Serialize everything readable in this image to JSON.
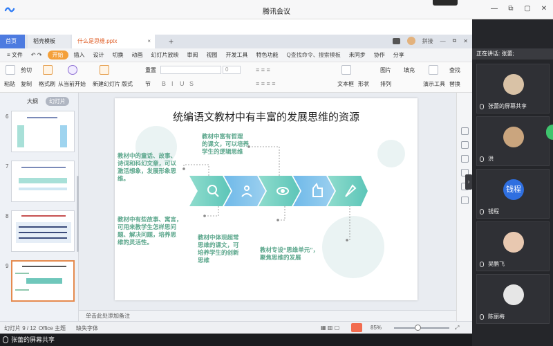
{
  "meeting": {
    "title": "腾讯会议",
    "screen_share_label": "张蕾的屏幕共享",
    "speaking_label": "正在讲话: 张蕾;",
    "win_min": "—",
    "win_restore": "⧉",
    "win_max": "▢",
    "win_close": "✕"
  },
  "wps": {
    "tabs": {
      "home": "首页",
      "template": "稻壳模板",
      "doc": "什么是思维.pptx",
      "add": "+"
    },
    "tabs_right": {
      "page_badge": "1",
      "user_label": "拼接"
    },
    "menu": {
      "file": "≡ 文件",
      "items": [
        "开始",
        "插入",
        "设计",
        "切换",
        "动画",
        "幻灯片放映",
        "审阅",
        "视图",
        "开发工具",
        "特色功能"
      ],
      "active_index": 0,
      "search": "Q查找命令、搜索模板",
      "unsync": "未同步",
      "collab": "协作",
      "share": "分享"
    },
    "ribbon": {
      "paste": "粘贴",
      "cut": "剪切",
      "copy": "复制",
      "format_painter": "格式刷",
      "play_from_current": "从当前开始",
      "new_slide": "新建幻灯片",
      "layout": "版式",
      "section": "节",
      "reset": "重置",
      "textbox": "文本框",
      "shape": "形状",
      "arrange": "排列",
      "picture": "图片",
      "fill": "填充",
      "find": "查找",
      "replace": "替换",
      "slideshow_tools": "演示工具",
      "font_placeholder": "",
      "size_placeholder": "0"
    },
    "panel": {
      "outline": "大纲",
      "slides": "幻灯片",
      "thumb_numbers": [
        "6",
        "7",
        "8",
        "9"
      ],
      "add": "+"
    },
    "slide": {
      "title": "统编语文教材中有丰富的发展思维的资源",
      "text_left_top": [
        "教材中的童话、故事、",
        "诗词和科幻文章，可以",
        "激活想象，发展形象思",
        "维。"
      ],
      "text_top_mid": [
        "教材中富有哲理",
        "的课文，可以培养",
        "学生的逻辑思维"
      ],
      "text_left_bottom": [
        "教材中有些故事、寓言，",
        "可用来教学生怎样思问",
        "题、解决问题，培养思",
        "维的灵活性。"
      ],
      "text_bottom_mid": [
        "教材中体现超常",
        "思维的课文，可",
        "培养学生的创新",
        "思维"
      ],
      "text_bottom_right": [
        "教材专设“思维单元”，",
        "聚焦思维的发展"
      ]
    },
    "notes": "单击此处添加备注",
    "status": {
      "slide_count": "幻灯片 9 / 12",
      "theme": "Office 主题",
      "missing_font": "缺失字体",
      "zoom": "85%",
      "zoom_level": 85
    }
  },
  "participants": [
    {
      "name": "张蕾的屏幕共享",
      "avatar": "photo"
    },
    {
      "name": "洪",
      "avatar": "photo"
    },
    {
      "name": "钱程",
      "avatar": "text",
      "avatar_text": "钱程"
    },
    {
      "name": "吴鹏飞",
      "avatar": "photo"
    },
    {
      "name": "陈丽梅",
      "avatar": "photo"
    }
  ],
  "colors": {
    "accent_blue": "#4d7be0",
    "active_orange": "#f4a03a",
    "slide_text_green": "#5aa68b",
    "chevron_teal": "#5cc5b8",
    "chevron_blue": "#6fa6e6",
    "play_red": "#f26c4f"
  }
}
